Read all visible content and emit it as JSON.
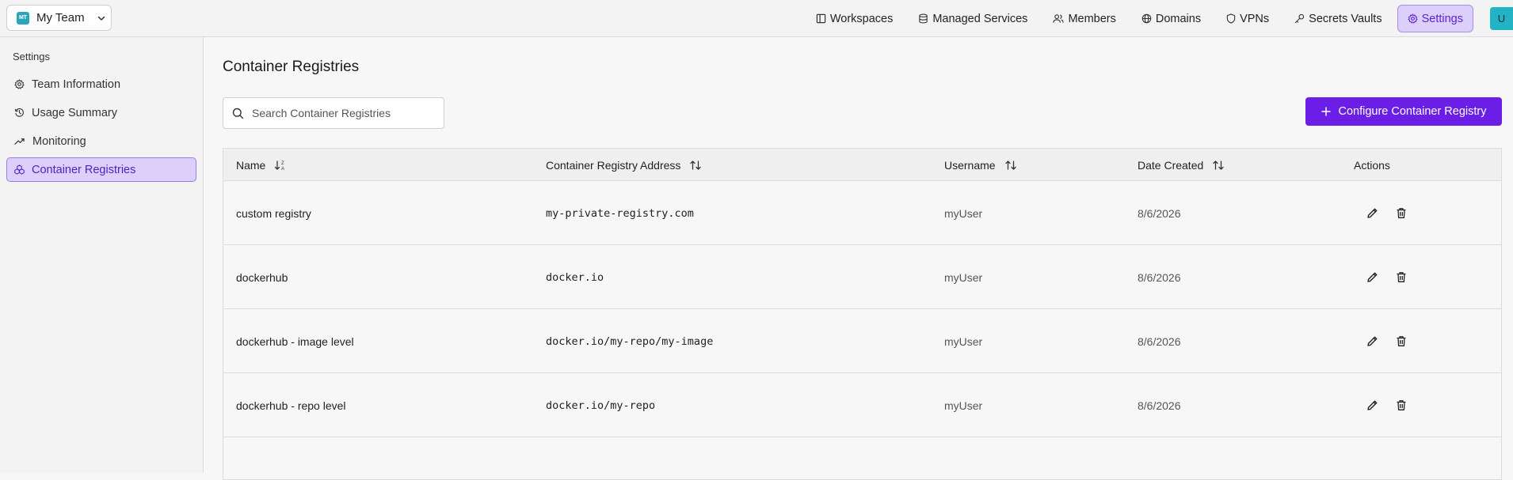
{
  "team": {
    "initials": "MT",
    "name": "My Team"
  },
  "nav": [
    {
      "label": "Workspaces",
      "icon": "workspaces-icon",
      "active": false
    },
    {
      "label": "Managed Services",
      "icon": "database-icon",
      "active": false
    },
    {
      "label": "Members",
      "icon": "members-icon",
      "active": false
    },
    {
      "label": "Domains",
      "icon": "globe-icon",
      "active": false
    },
    {
      "label": "VPNs",
      "icon": "shield-icon",
      "active": false
    },
    {
      "label": "Secrets Vaults",
      "icon": "key-icon",
      "active": false
    },
    {
      "label": "Settings",
      "icon": "gear-icon",
      "active": true
    }
  ],
  "user": {
    "initial": "U"
  },
  "sidebar": {
    "heading": "Settings",
    "items": [
      {
        "label": "Team Information",
        "icon": "gear-icon"
      },
      {
        "label": "Usage Summary",
        "icon": "history-icon"
      },
      {
        "label": "Monitoring",
        "icon": "trend-icon"
      },
      {
        "label": "Container Registries",
        "icon": "containers-icon"
      }
    ]
  },
  "main": {
    "title": "Container Registries",
    "search": {
      "placeholder": "Search Container Registries",
      "value": ""
    },
    "configure_label": "Configure Container Registry",
    "table": {
      "headers": {
        "name": "Name",
        "address": "Container Registry Address",
        "username": "Username",
        "date": "Date Created",
        "actions": "Actions"
      },
      "rows": [
        {
          "name": "custom registry",
          "address": "my-private-registry.com",
          "username": "myUser",
          "date": "8/6/2026"
        },
        {
          "name": "dockerhub",
          "address": "docker.io",
          "username": "myUser",
          "date": "8/6/2026"
        },
        {
          "name": "dockerhub - image level",
          "address": "docker.io/my-repo/my-image",
          "username": "myUser",
          "date": "8/6/2026"
        },
        {
          "name": "dockerhub - repo level",
          "address": "docker.io/my-repo",
          "username": "myUser",
          "date": "8/6/2026"
        }
      ]
    }
  },
  "colors": {
    "accent": "#6b1ee6",
    "active_bg": "#dcd0fa",
    "avatar": "#22b3c4"
  }
}
